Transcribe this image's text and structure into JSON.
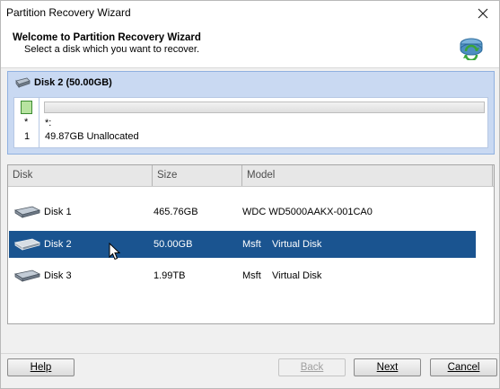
{
  "window": {
    "title": "Partition Recovery Wizard"
  },
  "header": {
    "title": "Welcome to Partition Recovery Wizard",
    "subtitle": "Select a disk which you want to recover."
  },
  "disk_panel": {
    "title": "Disk 2 (50.00GB)",
    "left_star": "*",
    "left_num": "1",
    "partition_label": "*:",
    "partition_size": "49.87GB Unallocated"
  },
  "table": {
    "columns": [
      "Disk",
      "Size",
      "Model"
    ],
    "rows": [
      {
        "disk": "Disk 1",
        "size": "465.76GB",
        "model": "WDC WD5000AAKX-001CA0",
        "selected": false
      },
      {
        "disk": "Disk 2",
        "size": "50.00GB",
        "model": "Msft    Virtual Disk",
        "selected": true
      },
      {
        "disk": "Disk 3",
        "size": "1.99TB",
        "model": "Msft    Virtual Disk",
        "selected": false
      }
    ]
  },
  "buttons": {
    "help": "Help",
    "back": "Back",
    "next": "Next",
    "cancel": "Cancel"
  },
  "colors": {
    "selection": "#1a5490",
    "panel": "#c9d9f2"
  }
}
